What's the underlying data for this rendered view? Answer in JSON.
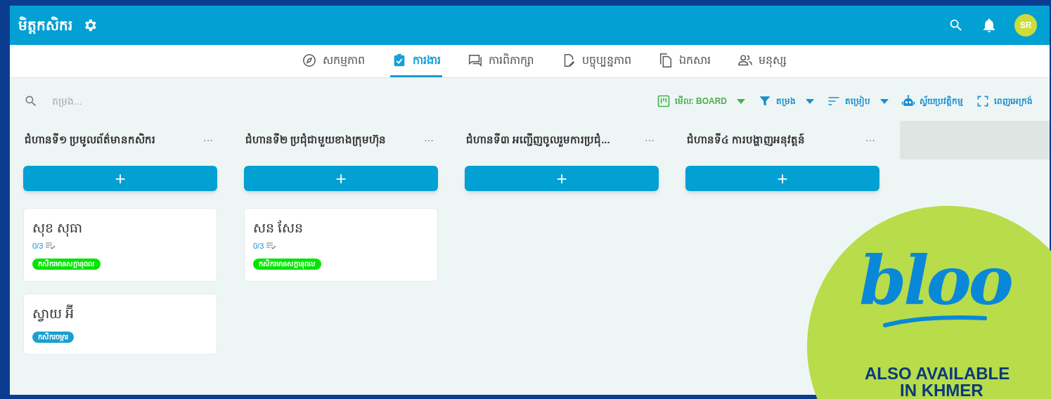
{
  "app_bar": {
    "title": "មិត្តកសិករ",
    "avatar": "SR"
  },
  "tabs": [
    {
      "label": "សកម្មភាព",
      "selected": false
    },
    {
      "label": "ការងារ",
      "selected": true
    },
    {
      "label": "ការពិភាក្សា",
      "selected": false
    },
    {
      "label": "បច្ចុប្បន្នភាព",
      "selected": false
    },
    {
      "label": "ឯកសារ",
      "selected": false
    },
    {
      "label": "មនុស្ស",
      "selected": false
    }
  ],
  "search": {
    "placeholder": "តម្រង..."
  },
  "toolbar": [
    {
      "label": "មើល: BOARD"
    },
    {
      "label": "តម្រង"
    },
    {
      "label": "តម្រៀប"
    },
    {
      "label": "ស្វ័យប្រវត្តិកម្ម"
    },
    {
      "label": "ពេញអេក្រង់"
    }
  ],
  "columns": [
    {
      "title": "ជំហានទី១ ប្រមូលព័ត៌មានកសិករ",
      "menu": "···",
      "add": "+",
      "cards": [
        {
          "title": "សុខ សុធា",
          "progress": "0/3",
          "complete": false,
          "tag": {
            "label": "កសិករមានសក្តានុពល",
            "color": "#00e600"
          }
        },
        {
          "title": "ស្វាយ អ៊ី",
          "tag": {
            "label": "កសិករចម្ការ",
            "color": "#1a9fd0"
          }
        }
      ]
    },
    {
      "title": "ជំហានទី២ ប្រជុំជាមួយខាងក្រុមហ៊ុន",
      "menu": "···",
      "add": "+",
      "cards": [
        {
          "title": "សន សែន",
          "progress": "0/3",
          "complete": false,
          "tag": {
            "label": "កសិករមានសក្តានុពល",
            "color": "#00e600"
          }
        }
      ]
    },
    {
      "title": "ជំហានទី៣ អញ្ជើញចូលរួមការប្រជុំ...",
      "menu": "···",
      "add": "+"
    },
    {
      "title": "ជំហានទី៤ ការបង្ហាញអនុវត្តន៍",
      "menu": "···",
      "add": "+"
    }
  ],
  "promo": {
    "logo": "bloo",
    "line_1": "ALSO AVAILABLE",
    "line_2": "IN KHMER"
  }
}
